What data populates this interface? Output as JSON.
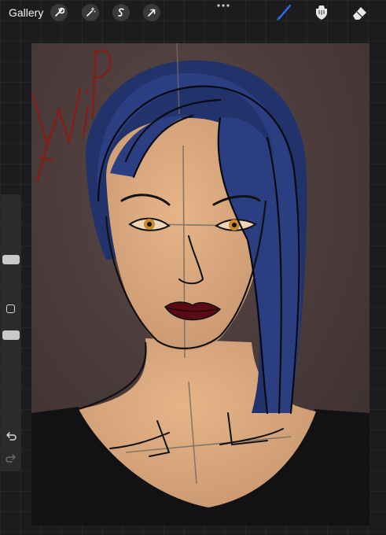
{
  "topbar": {
    "gallery_label": "Gallery",
    "left_tools": [
      "wrench-icon",
      "magic-wand-icon",
      "selection-icon",
      "transform-arrow-icon"
    ],
    "right_tools": [
      "brush-icon",
      "smudge-icon",
      "eraser-icon"
    ],
    "active_tool": "brush-icon",
    "accent_color": "#2b6df0"
  },
  "sidebar": {
    "size_slider_value": 0.7,
    "opacity_slider_value": 0.3,
    "controls": [
      "modify-button",
      "undo-button",
      "redo-button"
    ]
  },
  "canvas": {
    "background_color": "#4a3c3b",
    "wip_text": "WIP",
    "wip_color": "#8b1a12",
    "hair_color": "#22336b",
    "skin_color": "#e0aa7e",
    "eye_color": "#c98a2a",
    "lip_color": "#5a0c12"
  }
}
